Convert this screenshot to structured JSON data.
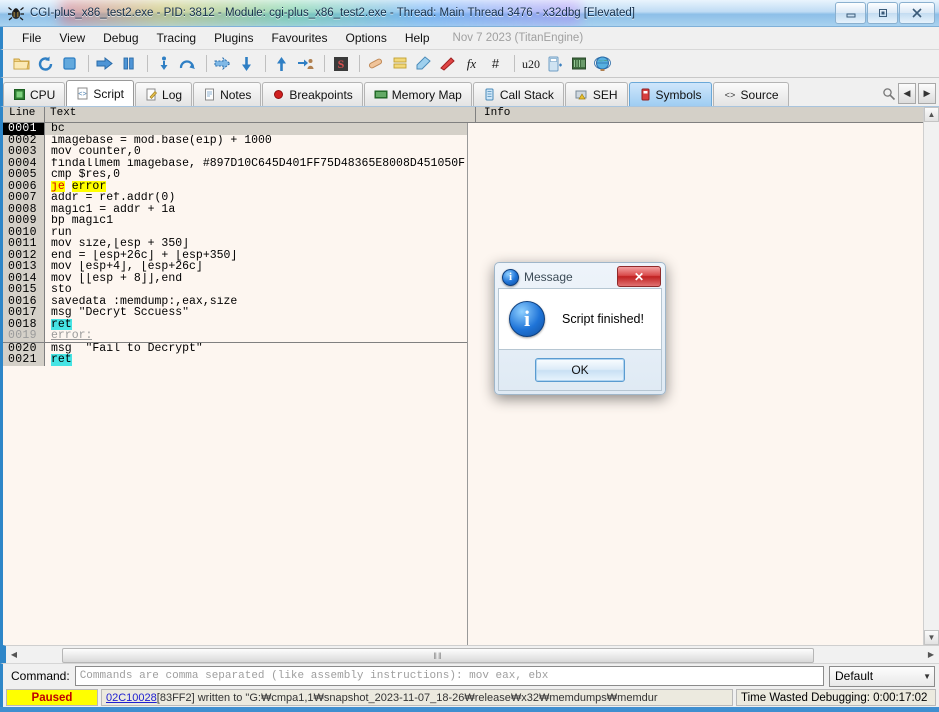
{
  "window": {
    "title": "CGI-plus_x86_test2.exe - PID: 3812 - Module: cgi-plus_x86_test2.exe - Thread: Main Thread 3476 - x32dbg [Elevated]",
    "app_icon": "bug-icon",
    "minimize_label": "–",
    "maximize_label": "▣",
    "close_label": "✕"
  },
  "menu": {
    "items": [
      "File",
      "View",
      "Debug",
      "Tracing",
      "Plugins",
      "Favourites",
      "Options",
      "Help"
    ],
    "note": "Nov 7 2023 (TitanEngine)"
  },
  "toolbar": {
    "buttons": [
      {
        "name": "open-icon",
        "glyph": "📁",
        "color": "#e8b33c"
      },
      {
        "name": "restart-icon",
        "glyph": "↺",
        "color": "#2f7fc4"
      },
      {
        "name": "stop-icon",
        "glyph": "■",
        "color": "#3f8fd0"
      },
      {
        "name": "run-icon",
        "glyph": "➡",
        "color": "#2f7fc4"
      },
      {
        "name": "pause-icon",
        "glyph": "❙❙",
        "color": "#2f7fc4"
      },
      {
        "name": "step-into-icon",
        "glyph": "↓",
        "color": "#2f7fc4"
      },
      {
        "name": "step-over-icon",
        "glyph": "↷",
        "color": "#2f7fc4"
      },
      {
        "name": "step-out-icon",
        "glyph": "↪",
        "color": "#2f7fc4"
      },
      {
        "name": "trace-into-icon",
        "glyph": "⬇",
        "color": "#2f7fc4"
      },
      {
        "name": "trace-over-icon",
        "glyph": "⬆",
        "color": "#2f7fc4"
      },
      {
        "name": "run-to-user-icon",
        "glyph": "⇥",
        "color": "#6a8fb0"
      },
      {
        "name": "scylla-icon",
        "glyph": "S",
        "color": "#c03030"
      },
      {
        "name": "patch-icon",
        "glyph": "╱",
        "color": "#e0a070"
      },
      {
        "name": "log-icon",
        "glyph": "☰",
        "color": "#e0c040"
      },
      {
        "name": "comment-icon",
        "glyph": "✎",
        "color": "#6fa8d8"
      },
      {
        "name": "bookmark-icon",
        "glyph": "✒",
        "color": "#d04040"
      },
      {
        "name": "function-icon",
        "glyph": "fx",
        "color": "#222222"
      },
      {
        "name": "hash-icon",
        "glyph": "#",
        "color": "#222222"
      },
      {
        "name": "font-icon",
        "glyph": "A₂",
        "color": "#222222"
      },
      {
        "name": "calculator-icon",
        "glyph": "▤",
        "color": "#5f9ad0"
      },
      {
        "name": "memory-icon",
        "glyph": "▦",
        "color": "#4a7a4a"
      },
      {
        "name": "globe-icon",
        "glyph": "🌐",
        "color": "#2f8fc4"
      }
    ]
  },
  "tabs": [
    {
      "label": "CPU",
      "icon": "cpu-icon",
      "state": "normal"
    },
    {
      "label": "Script",
      "icon": "script-icon",
      "state": "active"
    },
    {
      "label": "Log",
      "icon": "log-icon",
      "state": "normal"
    },
    {
      "label": "Notes",
      "icon": "notes-icon",
      "state": "normal"
    },
    {
      "label": "Breakpoints",
      "icon": "breakpoint-icon",
      "state": "normal"
    },
    {
      "label": "Memory Map",
      "icon": "memory-map-icon",
      "state": "normal"
    },
    {
      "label": "Call Stack",
      "icon": "call-stack-icon",
      "state": "normal"
    },
    {
      "label": "SEH",
      "icon": "seh-icon",
      "state": "normal"
    },
    {
      "label": "Symbols",
      "icon": "symbols-icon",
      "state": "selected"
    },
    {
      "label": "Source",
      "icon": "source-icon",
      "state": "normal"
    }
  ],
  "tab_nav": {
    "search_icon": "magnifier-icon",
    "prev_label": "◀",
    "next_label": "▶"
  },
  "script_panel": {
    "columns": {
      "line": "Line",
      "text": "Text",
      "info": "Info"
    },
    "rows": [
      {
        "line": "0001",
        "text": "bc",
        "style": "current"
      },
      {
        "line": "0002",
        "text": "imagebase = mod.base(eip) + 1000",
        "style": "normal"
      },
      {
        "line": "0003",
        "text": "mov counter,0",
        "style": "normal"
      },
      {
        "line": "0004",
        "text": "findallmem imagebase, #897D10C645D401FF75D48365E8008D451050F",
        "style": "normal"
      },
      {
        "line": "0005",
        "text": "cmp $res,0",
        "style": "normal"
      },
      {
        "line": "0006",
        "text": "je error",
        "style": "highlight-yellow",
        "keyword": "je",
        "operand": "error"
      },
      {
        "line": "0007",
        "text": "addr = ref.addr(0)",
        "style": "normal"
      },
      {
        "line": "0008",
        "text": "magic1 = addr + 1a",
        "style": "normal"
      },
      {
        "line": "0009",
        "text": "bp magic1",
        "style": "normal"
      },
      {
        "line": "0010",
        "text": "run",
        "style": "normal"
      },
      {
        "line": "0011",
        "text": "mov size,[esp + 350]",
        "style": "normal"
      },
      {
        "line": "0012",
        "text": "end = [esp+26c] + [esp+350]",
        "style": "normal"
      },
      {
        "line": "0013",
        "text": "mov [esp+4], [esp+26c]",
        "style": "normal"
      },
      {
        "line": "0014",
        "text": "mov [[esp + 8]],end",
        "style": "normal"
      },
      {
        "line": "0015",
        "text": "sto",
        "style": "normal"
      },
      {
        "line": "0016",
        "text": "savedata :memdump:,eax,size",
        "style": "normal"
      },
      {
        "line": "0017",
        "text": "msg \"Decryt Sccuess\"",
        "style": "normal"
      },
      {
        "line": "0018",
        "text": "ret",
        "style": "highlight-cyan"
      },
      {
        "line": "0019",
        "text": "error:",
        "style": "label"
      },
      {
        "line": "0020",
        "text": "msg  \"Fail to Decrypt\"",
        "style": "normal"
      },
      {
        "line": "0021",
        "text": "ret",
        "style": "highlight-cyan"
      }
    ]
  },
  "scroll": {
    "up_arrow": "▲",
    "down_arrow": "▼",
    "left_arrow": "◀",
    "right_arrow": "▶",
    "grip": "‖‖"
  },
  "command": {
    "label": "Command:",
    "placeholder": "Commands are comma separated (like assembly instructions): mov eax, ebx",
    "value": "",
    "combo_value": "Default",
    "combo_arrow": "▼"
  },
  "status": {
    "state": "Paused",
    "log_address": "02C10028",
    "log_text": "[83FF2]  written to  \"G:₩cmpa1,1₩snapshot_2023-11-07_18-26₩release₩x32₩memdumps₩memdur",
    "time_wasted": "Time Wasted Debugging: 0:00:17:02"
  },
  "dialog": {
    "title": "Message",
    "title_icon": "info-icon",
    "body_icon": "info-icon",
    "message": "Script finished!",
    "ok_label": "OK",
    "close_label": "✕"
  },
  "colors": {
    "accent": "#2e86c8",
    "highlight_yellow": "#ffff00",
    "highlight_cyan": "#46e4e4",
    "keyword_red": "#d40000",
    "paused_text": "#c00000",
    "link_blue": "#2020d0"
  }
}
